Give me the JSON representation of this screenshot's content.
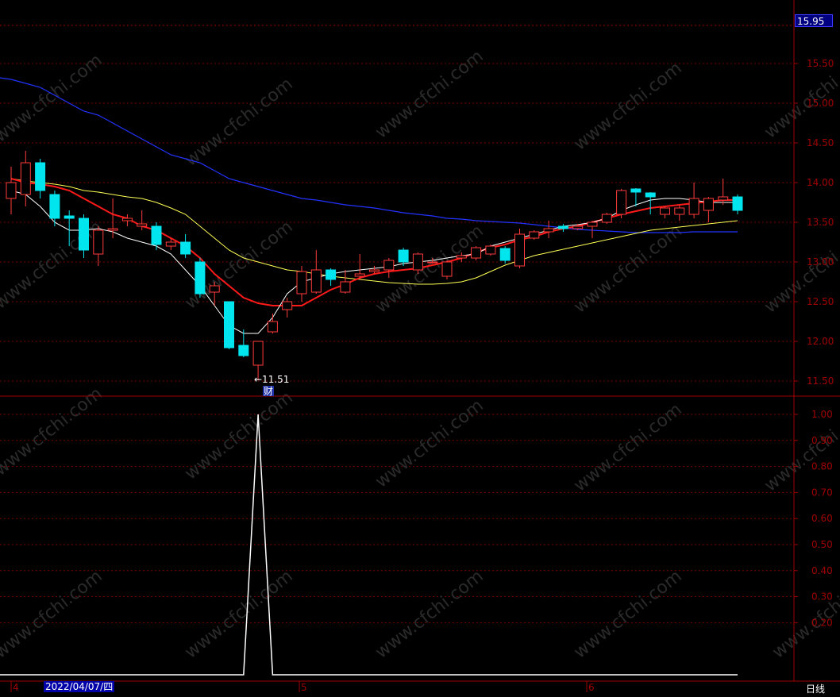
{
  "current_price": "15.95",
  "cursor_date": "2022/04/07/四",
  "period_label": "日线",
  "month_labels": [
    "4",
    "5",
    "6"
  ],
  "low_marker": {
    "arrow": "←",
    "value": "11.51",
    "tag": "财"
  },
  "watermark": "www.cfchi.com",
  "colors": {
    "up": "#ff3b3b",
    "down": "#00e5ee",
    "ma5": "#ffffff",
    "ma10": "#ff1a1a",
    "ma20": "#ffff55",
    "ma60": "#2233ff",
    "axis": "#a00000"
  },
  "chart_data": [
    {
      "type": "candlestick",
      "y_ticks": [
        "15.50",
        "15.00",
        "14.50",
        "14.00",
        "13.50",
        "13.00",
        "12.50",
        "12.00",
        "11.50"
      ],
      "ylim": [
        11.4,
        16.0
      ],
      "candles": [
        {
          "o": 13.8,
          "c": 14.0,
          "h": 14.2,
          "l": 13.6
        },
        {
          "o": 13.85,
          "c": 14.25,
          "h": 14.4,
          "l": 13.7
        },
        {
          "o": 14.25,
          "c": 13.9,
          "h": 14.3,
          "l": 13.8
        },
        {
          "o": 13.85,
          "c": 13.55,
          "h": 13.9,
          "l": 13.45
        },
        {
          "o": 13.58,
          "c": 13.55,
          "h": 13.65,
          "l": 13.2
        },
        {
          "o": 13.55,
          "c": 13.15,
          "h": 13.6,
          "l": 13.05
        },
        {
          "o": 13.1,
          "c": 13.4,
          "h": 13.45,
          "l": 12.95
        },
        {
          "o": 13.4,
          "c": 13.42,
          "h": 13.8,
          "l": 13.3
        },
        {
          "o": 13.52,
          "c": 13.55,
          "h": 13.6,
          "l": 13.45
        },
        {
          "o": 13.45,
          "c": 13.48,
          "h": 13.65,
          "l": 13.4
        },
        {
          "o": 13.45,
          "c": 13.22,
          "h": 13.5,
          "l": 13.15
        },
        {
          "o": 13.2,
          "c": 13.25,
          "h": 13.3,
          "l": 13.15
        },
        {
          "o": 13.25,
          "c": 13.1,
          "h": 13.35,
          "l": 13.05
        },
        {
          "o": 13.0,
          "c": 12.6,
          "h": 13.05,
          "l": 12.55
        },
        {
          "o": 12.62,
          "c": 12.7,
          "h": 12.75,
          "l": 12.45
        },
        {
          "o": 12.5,
          "c": 11.92,
          "h": 12.5,
          "l": 11.9
        },
        {
          "o": 11.95,
          "c": 11.82,
          "h": 12.15,
          "l": 11.8
        },
        {
          "o": 11.7,
          "c": 12.0,
          "h": 12.0,
          "l": 11.51
        },
        {
          "o": 12.12,
          "c": 12.25,
          "h": 12.35,
          "l": 12.1
        },
        {
          "o": 12.4,
          "c": 12.5,
          "h": 12.55,
          "l": 12.3
        },
        {
          "o": 12.6,
          "c": 12.88,
          "h": 12.95,
          "l": 12.5
        },
        {
          "o": 12.62,
          "c": 12.9,
          "h": 13.15,
          "l": 12.6
        },
        {
          "o": 12.9,
          "c": 12.78,
          "h": 12.92,
          "l": 12.7
        },
        {
          "o": 12.62,
          "c": 12.75,
          "h": 12.9,
          "l": 12.6
        },
        {
          "o": 12.82,
          "c": 12.85,
          "h": 13.1,
          "l": 12.78
        },
        {
          "o": 12.88,
          "c": 12.9,
          "h": 12.95,
          "l": 12.85
        },
        {
          "o": 12.9,
          "c": 13.02,
          "h": 13.05,
          "l": 12.8
        },
        {
          "o": 13.15,
          "c": 13.0,
          "h": 13.18,
          "l": 12.95
        },
        {
          "o": 12.9,
          "c": 13.1,
          "h": 13.12,
          "l": 12.85
        },
        {
          "o": 13.0,
          "c": 13.0,
          "h": 13.05,
          "l": 12.98
        },
        {
          "o": 12.82,
          "c": 13.0,
          "h": 13.02,
          "l": 12.78
        },
        {
          "o": 13.05,
          "c": 13.08,
          "h": 13.12,
          "l": 13.0
        },
        {
          "o": 13.05,
          "c": 13.18,
          "h": 13.2,
          "l": 13.02
        },
        {
          "o": 13.1,
          "c": 13.2,
          "h": 13.22,
          "l": 13.08
        },
        {
          "o": 13.17,
          "c": 13.02,
          "h": 13.2,
          "l": 12.98
        },
        {
          "o": 12.95,
          "c": 13.35,
          "h": 13.42,
          "l": 12.92
        },
        {
          "o": 13.3,
          "c": 13.38,
          "h": 13.4,
          "l": 13.28
        },
        {
          "o": 13.38,
          "c": 13.42,
          "h": 13.52,
          "l": 13.3
        },
        {
          "o": 13.45,
          "c": 13.42,
          "h": 13.48,
          "l": 13.38
        },
        {
          "o": 13.42,
          "c": 13.45,
          "h": 13.48,
          "l": 13.4
        },
        {
          "o": 13.45,
          "c": 13.5,
          "h": 13.52,
          "l": 13.3
        },
        {
          "o": 13.5,
          "c": 13.6,
          "h": 13.62,
          "l": 13.48
        },
        {
          "o": 13.6,
          "c": 13.9,
          "h": 13.92,
          "l": 13.55
        },
        {
          "o": 13.92,
          "c": 13.88,
          "h": 13.93,
          "l": 13.7
        },
        {
          "o": 13.87,
          "c": 13.82,
          "h": 13.88,
          "l": 13.6
        },
        {
          "o": 13.6,
          "c": 13.68,
          "h": 13.7,
          "l": 13.55
        },
        {
          "o": 13.6,
          "c": 13.68,
          "h": 13.72,
          "l": 13.52
        },
        {
          "o": 13.6,
          "c": 13.8,
          "h": 14.0,
          "l": 13.55
        },
        {
          "o": 13.65,
          "c": 13.8,
          "h": 13.82,
          "l": 13.5
        },
        {
          "o": 13.78,
          "c": 13.82,
          "h": 14.05,
          "l": 13.72
        },
        {
          "o": 13.82,
          "c": 13.65,
          "h": 13.85,
          "l": 13.6
        }
      ],
      "ma5": [
        13.9,
        13.85,
        13.7,
        13.5,
        13.4,
        13.4,
        13.42,
        13.38,
        13.3,
        13.25,
        13.2,
        13.1,
        12.9,
        12.7,
        12.45,
        12.2,
        12.1,
        12.1,
        12.3,
        12.6,
        12.75,
        12.8,
        12.85,
        12.88,
        12.9,
        12.92,
        12.94,
        12.98,
        13.0,
        13.02,
        13.05,
        13.08,
        13.1,
        13.2,
        13.25,
        13.3,
        13.35,
        13.4,
        13.45,
        13.47,
        13.5,
        13.55,
        13.65,
        13.72,
        13.78,
        13.8,
        13.8,
        13.78,
        13.75,
        13.75,
        13.75
      ],
      "ma10": [
        14.05,
        14.0,
        13.98,
        13.95,
        13.9,
        13.8,
        13.7,
        13.6,
        13.55,
        13.45,
        13.4,
        13.3,
        13.2,
        13.05,
        12.85,
        12.7,
        12.55,
        12.48,
        12.45,
        12.45,
        12.45,
        12.55,
        12.65,
        12.72,
        12.8,
        12.85,
        12.88,
        12.9,
        12.92,
        12.96,
        13.0,
        13.05,
        13.12,
        13.18,
        13.22,
        13.28,
        13.32,
        13.38,
        13.42,
        13.45,
        13.5,
        13.55,
        13.6,
        13.64,
        13.68,
        13.7,
        13.72,
        13.74,
        13.76,
        13.78,
        13.78
      ],
      "ma20": [
        14.05,
        14.02,
        14.0,
        13.98,
        13.95,
        13.9,
        13.88,
        13.85,
        13.82,
        13.8,
        13.75,
        13.68,
        13.6,
        13.45,
        13.3,
        13.15,
        13.05,
        13.0,
        12.95,
        12.9,
        12.88,
        12.85,
        12.82,
        12.8,
        12.78,
        12.76,
        12.74,
        12.73,
        12.72,
        12.72,
        12.73,
        12.75,
        12.8,
        12.88,
        12.96,
        13.02,
        13.08,
        13.12,
        13.16,
        13.2,
        13.24,
        13.28,
        13.32,
        13.36,
        13.4,
        13.42,
        13.44,
        13.46,
        13.48,
        13.5,
        13.52
      ],
      "ma60": [
        15.3,
        15.25,
        15.2,
        15.1,
        15.0,
        14.9,
        14.85,
        14.75,
        14.65,
        14.55,
        14.45,
        14.35,
        14.3,
        14.25,
        14.15,
        14.05,
        14.0,
        13.95,
        13.9,
        13.85,
        13.8,
        13.78,
        13.75,
        13.72,
        13.7,
        13.68,
        13.65,
        13.62,
        13.6,
        13.58,
        13.55,
        13.54,
        13.52,
        13.51,
        13.5,
        13.49,
        13.47,
        13.45,
        13.43,
        13.41,
        13.4,
        13.39,
        13.38,
        13.37,
        13.37,
        13.37,
        13.37,
        13.38,
        13.38,
        13.38,
        13.38
      ]
    },
    {
      "type": "line",
      "y_ticks": [
        "1.00",
        "0.90",
        "0.80",
        "0.70",
        "0.60",
        "0.50",
        "0.40",
        "0.30",
        "0.20"
      ],
      "ylim": [
        -0.2,
        1.0
      ],
      "values": [
        0,
        0,
        0,
        0,
        0,
        0,
        0,
        0,
        0,
        0,
        0,
        0,
        0,
        0,
        0,
        0,
        0,
        1,
        0,
        0,
        0,
        0,
        0,
        0,
        0,
        0,
        0,
        0,
        0,
        0,
        0,
        0,
        0,
        0,
        0,
        0,
        0,
        0,
        0,
        0,
        0,
        0,
        0,
        0,
        0,
        0,
        0,
        0,
        0,
        0,
        0
      ]
    }
  ]
}
